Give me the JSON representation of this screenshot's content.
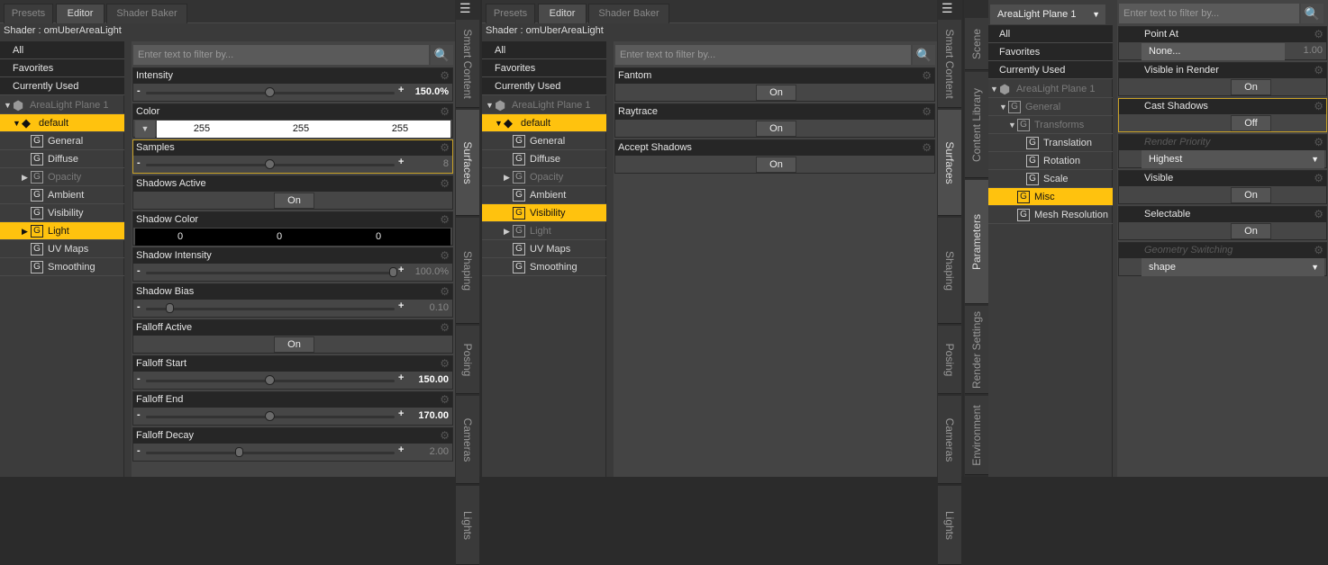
{
  "colors": {
    "accent": "#ffc20e",
    "highlight_border": "#c9a227",
    "panel": "#3a3a3a",
    "header": "#262626"
  },
  "surfaces_panels": [
    {
      "tabs": [
        "Presets",
        "Editor",
        "Shader Baker"
      ],
      "active_tab": 1,
      "shader_label": "Shader : omUberAreaLight",
      "filter_placeholder": "Enter text to filter by...",
      "categories": [
        "All",
        "Favorites",
        "Currently Used"
      ],
      "tree": [
        {
          "label": "AreaLight Plane 1",
          "icon": "cube-icon",
          "level": 0,
          "expanded": true,
          "dim": true
        },
        {
          "label": "default",
          "icon": "surface-icon",
          "level": 1,
          "expanded": true,
          "selected": true
        },
        {
          "label": "General",
          "icon": "group-icon",
          "level": 2
        },
        {
          "label": "Diffuse",
          "icon": "group-icon",
          "level": 2
        },
        {
          "label": "Opacity",
          "icon": "group-icon",
          "level": 2,
          "collapsed": true,
          "dim": true
        },
        {
          "label": "Ambient",
          "icon": "group-icon",
          "level": 2
        },
        {
          "label": "Visibility",
          "icon": "group-icon",
          "level": 2
        },
        {
          "label": "Light",
          "icon": "group-icon",
          "level": 2,
          "collapsed": true,
          "selected": true
        },
        {
          "label": "UV Maps",
          "icon": "group-icon",
          "level": 2
        },
        {
          "label": "Smoothing",
          "icon": "group-icon",
          "level": 2
        }
      ],
      "params": [
        {
          "label": "Intensity",
          "type": "slider",
          "value": "150.0%",
          "position": 0.5,
          "modified": true
        },
        {
          "label": "Color",
          "type": "color",
          "values": [
            "255",
            "255",
            "255"
          ]
        },
        {
          "label": "Samples",
          "type": "slider",
          "value": "8",
          "position": 0.5,
          "highlight": true
        },
        {
          "label": "Shadows Active",
          "type": "toggle",
          "value": "On"
        },
        {
          "label": "Shadow Color",
          "type": "color",
          "values": [
            "0",
            "0",
            "0"
          ],
          "black": true
        },
        {
          "label": "Shadow Intensity",
          "type": "slider",
          "value": "100.0%",
          "position": 1.0
        },
        {
          "label": "Shadow Bias",
          "type": "slider",
          "value": "0.10",
          "position": 0.1
        },
        {
          "label": "Falloff Active",
          "type": "toggle",
          "value": "On"
        },
        {
          "label": "Falloff Start",
          "type": "slider",
          "value": "150.00",
          "position": 0.5,
          "modified": true
        },
        {
          "label": "Falloff End",
          "type": "slider",
          "value": "170.00",
          "position": 0.5,
          "modified": true
        },
        {
          "label": "Falloff Decay",
          "type": "slider",
          "value": "2.00",
          "position": 0.38
        }
      ],
      "side_tabs": [
        "Smart Content",
        "Surfaces",
        "Shaping",
        "Posing",
        "Cameras",
        "Lights"
      ],
      "active_side_tab": 1
    },
    {
      "tabs": [
        "Presets",
        "Editor",
        "Shader Baker"
      ],
      "active_tab": 1,
      "shader_label": "Shader : omUberAreaLight",
      "filter_placeholder": "Enter text to filter by...",
      "categories": [
        "All",
        "Favorites",
        "Currently Used"
      ],
      "tree": [
        {
          "label": "AreaLight Plane 1",
          "icon": "cube-icon",
          "level": 0,
          "expanded": true,
          "dim": true
        },
        {
          "label": "default",
          "icon": "surface-icon",
          "level": 1,
          "expanded": true,
          "selected": true
        },
        {
          "label": "General",
          "icon": "group-icon",
          "level": 2
        },
        {
          "label": "Diffuse",
          "icon": "group-icon",
          "level": 2
        },
        {
          "label": "Opacity",
          "icon": "group-icon",
          "level": 2,
          "collapsed": true,
          "dim": true
        },
        {
          "label": "Ambient",
          "icon": "group-icon",
          "level": 2
        },
        {
          "label": "Visibility",
          "icon": "group-icon",
          "level": 2,
          "selected": true
        },
        {
          "label": "Light",
          "icon": "group-icon",
          "level": 2,
          "collapsed": true,
          "dim": true
        },
        {
          "label": "UV Maps",
          "icon": "group-icon",
          "level": 2
        },
        {
          "label": "Smoothing",
          "icon": "group-icon",
          "level": 2
        }
      ],
      "params": [
        {
          "label": "Fantom",
          "type": "toggle",
          "value": "On"
        },
        {
          "label": "Raytrace",
          "type": "toggle",
          "value": "On"
        },
        {
          "label": "Accept Shadows",
          "type": "toggle",
          "value": "On"
        }
      ],
      "side_tabs": [
        "Smart Content",
        "Surfaces",
        "Shaping",
        "Posing",
        "Cameras",
        "Lights"
      ],
      "active_side_tab": 1
    }
  ],
  "parameters_panel": {
    "side_tabs": [
      "Scene",
      "Content Library",
      "Parameters",
      "Render Settings",
      "Environment"
    ],
    "active_side_tab": 2,
    "node_select": "AreaLight Plane 1",
    "filter_placeholder": "Enter text to filter by...",
    "categories": [
      "All",
      "Favorites",
      "Currently Used"
    ],
    "tree": [
      {
        "label": "AreaLight Plane 1",
        "icon": "cube-icon",
        "level": 0,
        "expanded": true,
        "dim": true
      },
      {
        "label": "General",
        "icon": "group-icon",
        "level": 1,
        "expanded": true,
        "dim": true
      },
      {
        "label": "Transforms",
        "icon": "group-icon",
        "level": 2,
        "expanded": true,
        "dim": true
      },
      {
        "label": "Translation",
        "icon": "group-icon",
        "level": 3
      },
      {
        "label": "Rotation",
        "icon": "group-icon",
        "level": 3
      },
      {
        "label": "Scale",
        "icon": "group-icon",
        "level": 3
      },
      {
        "label": "Misc",
        "icon": "group-icon",
        "level": 2,
        "selected": true
      },
      {
        "label": "Mesh Resolution",
        "icon": "group-icon",
        "level": 2
      }
    ],
    "params": [
      {
        "label": "Point At",
        "type": "node",
        "value": "None...",
        "number": "1.00"
      },
      {
        "label": "Visible in Render",
        "type": "toggle",
        "value": "On"
      },
      {
        "label": "Cast Shadows",
        "type": "toggle",
        "value": "Off",
        "highlight": true
      },
      {
        "label": "Render Priority",
        "type": "dropdown",
        "value": "Highest",
        "dim": true
      },
      {
        "label": "Visible",
        "type": "toggle",
        "value": "On"
      },
      {
        "label": "Selectable",
        "type": "toggle",
        "value": "On"
      },
      {
        "label": "Geometry Switching",
        "type": "dropdown",
        "value": "shape",
        "dim": true
      }
    ]
  }
}
